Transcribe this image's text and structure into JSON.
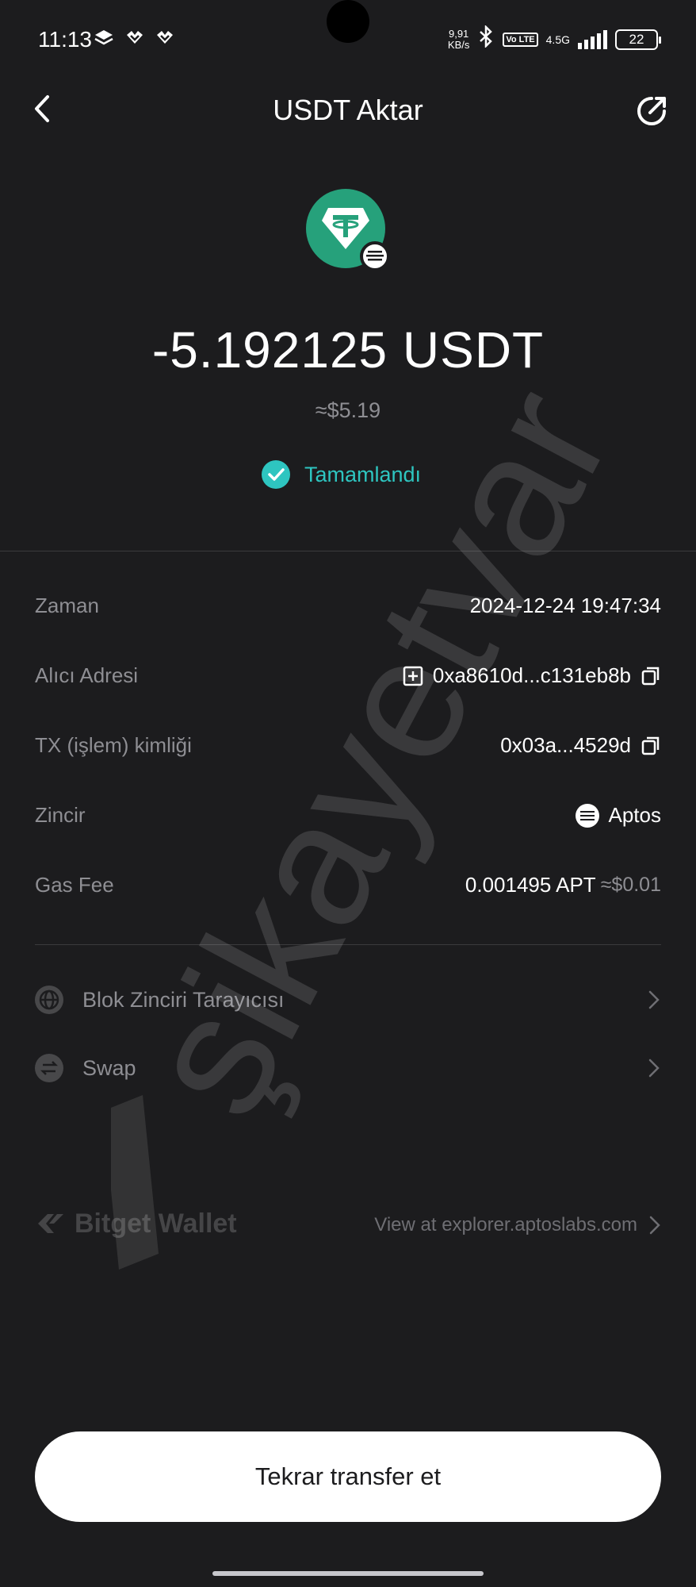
{
  "status_bar": {
    "time": "11:13",
    "net_speed_value": "9,91",
    "net_speed_unit": "KB/s",
    "volte": "Vo LTE",
    "network": "4.5G",
    "battery": "22"
  },
  "header": {
    "title": "USDT Aktar"
  },
  "transaction": {
    "amount": "-5.192125 USDT",
    "fiat": "≈$5.19",
    "status": "Tamamlandı",
    "status_color": "#2ec5c0"
  },
  "details": {
    "time_label": "Zaman",
    "time_value": "2024-12-24 19:47:34",
    "recipient_label": "Alıcı Adresi",
    "recipient_value": "0xa8610d...c131eb8b",
    "txid_label": "TX (işlem) kimliği",
    "txid_value": "0x03a...4529d",
    "chain_label": "Zincir",
    "chain_value": "Aptos",
    "gas_label": "Gas Fee",
    "gas_value": "0.001495 APT",
    "gas_fiat": "≈$0.01"
  },
  "links": {
    "explorer_label": "Blok Zinciri Tarayıcısı",
    "swap_label": "Swap"
  },
  "footer": {
    "brand": "Bitget Wallet",
    "explorer_link": "View at explorer.aptoslabs.com",
    "cta": "Tekrar transfer et"
  },
  "watermark": {
    "text": "şikayetvar"
  },
  "colors": {
    "background": "#1c1c1e",
    "accent": "#2ec5c0",
    "usdt_green": "#26a17b"
  }
}
